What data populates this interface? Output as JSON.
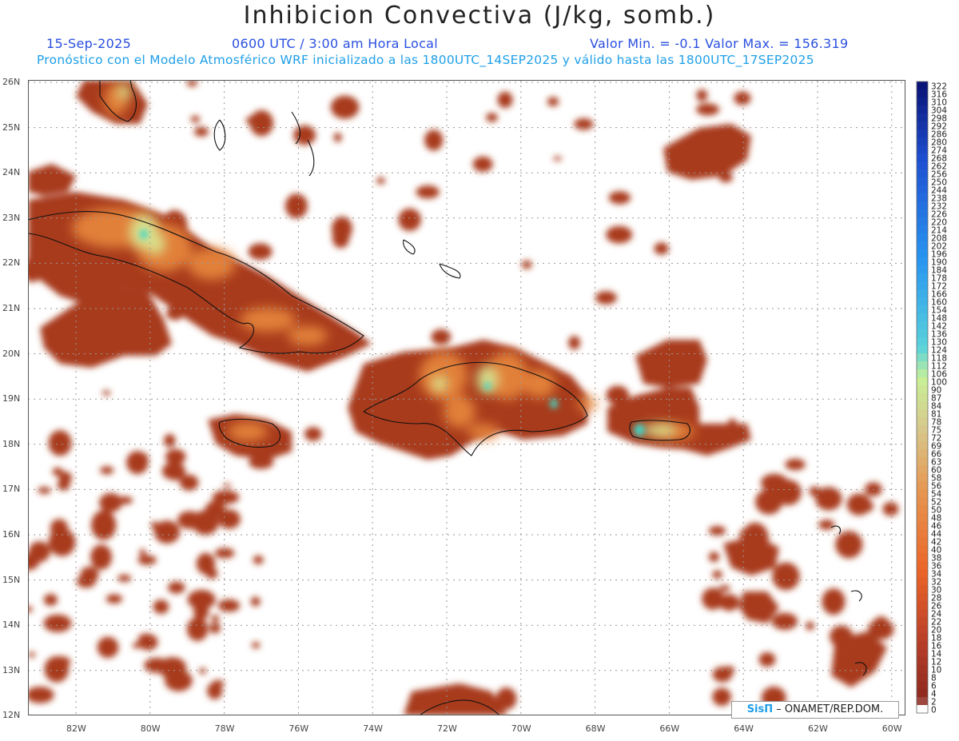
{
  "header": {
    "title": "Inhibicion Convectiva (J/kg, somb.)",
    "date": "15-Sep-2025",
    "time": "0600 UTC / 3:00 am Hora Local",
    "minmax": "Valor Min. = -0.1  Valor Max. = 156.319",
    "model_info": "Pronóstico con el Modelo Atmosférico WRF inicializado a las 1800UTC_14SEP2025 y válido hasta las  1800UTC_17SEP2025"
  },
  "map": {
    "lat_labels": [
      "26N",
      "25N",
      "24N",
      "23N",
      "22N",
      "21N",
      "20N",
      "19N",
      "18N",
      "17N",
      "16N",
      "15N",
      "14N",
      "13N",
      "12N"
    ],
    "lon_labels": [
      "82W",
      "80W",
      "78W",
      "76W",
      "74W",
      "72W",
      "70W",
      "68W",
      "66W",
      "64W",
      "62W",
      "60W"
    ],
    "fill_colors": {
      "low": "#a83a1c",
      "mid": "#e8883c",
      "high": "#d9ef9a",
      "peak": "#40d8c8"
    }
  },
  "colorbar": {
    "labels": [
      "322",
      "316",
      "310",
      "304",
      "298",
      "292",
      "286",
      "280",
      "274",
      "268",
      "262",
      "256",
      "250",
      "244",
      "238",
      "232",
      "226",
      "220",
      "214",
      "208",
      "202",
      "196",
      "190",
      "184",
      "178",
      "172",
      "166",
      "160",
      "154",
      "148",
      "142",
      "136",
      "130",
      "124",
      "118",
      "112",
      "106",
      "100",
      "90",
      "87",
      "84",
      "81",
      "78",
      "75",
      "72",
      "69",
      "66",
      "63",
      "60",
      "58",
      "56",
      "54",
      "52",
      "50",
      "48",
      "46",
      "44",
      "42",
      "40",
      "38",
      "36",
      "34",
      "32",
      "30",
      "28",
      "26",
      "24",
      "22",
      "20",
      "18",
      "16",
      "14",
      "12",
      "10",
      "8",
      "6",
      "4",
      "2",
      "0"
    ]
  },
  "credit": {
    "logo": "SisΠ",
    "text": "– ONAMET/REP.DOM."
  }
}
